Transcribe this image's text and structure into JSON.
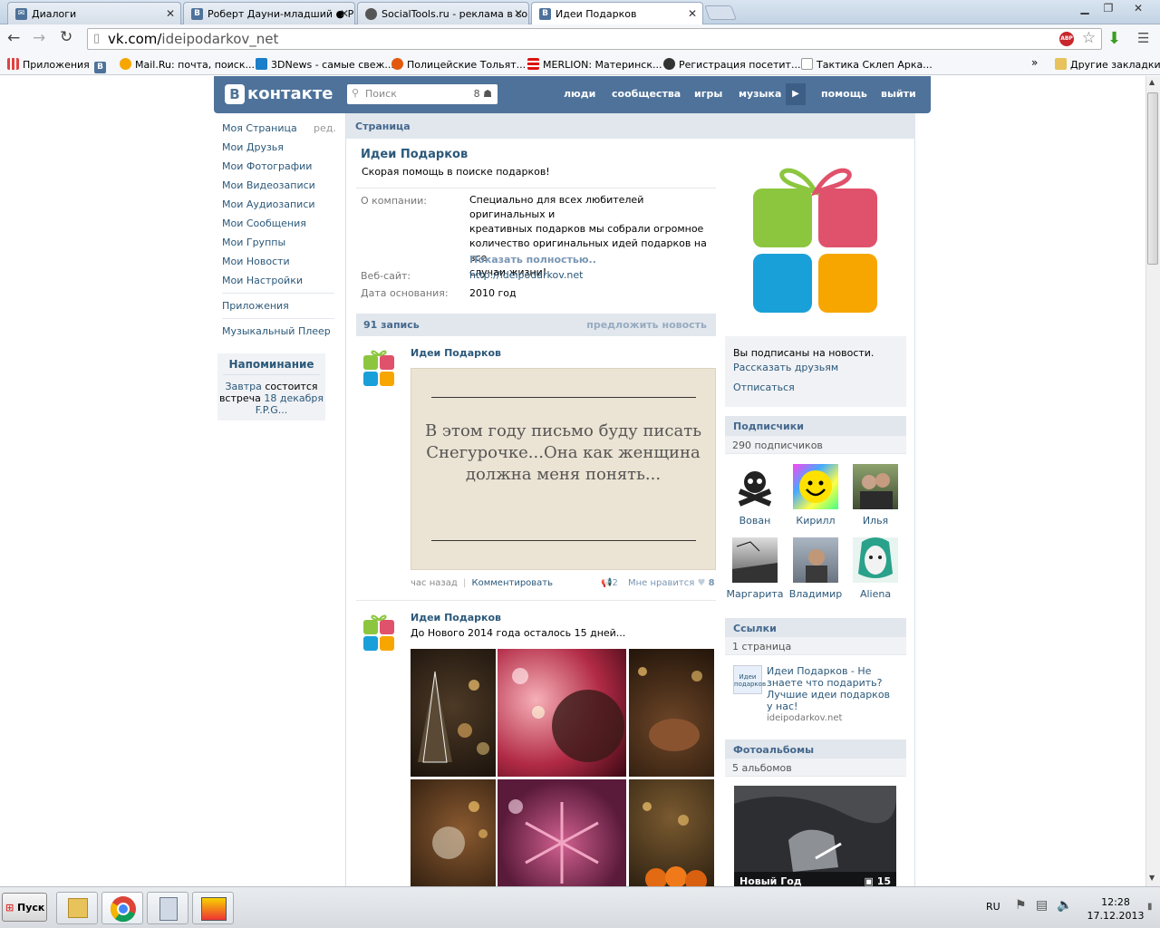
{
  "browser": {
    "tabs": [
      {
        "title": "Диалоги"
      },
      {
        "title": "Роберт Дауни-младший ● Р"
      },
      {
        "title": "SocialTools.ru - реклама в со"
      },
      {
        "title": "Идеи Подарков"
      }
    ],
    "url_host": "vk.com/",
    "url_path": "ideipodarkov_net",
    "bookmarks": [
      {
        "label": "Приложения",
        "icon": "apps-grid-icon"
      },
      {
        "label": "",
        "icon": "vk-icon"
      },
      {
        "label": "Mail.Ru: почта, поиск...",
        "icon": "mailru-icon"
      },
      {
        "label": "3DNews - самые свеж...",
        "icon": "3dnews-icon"
      },
      {
        "label": "Полицейские Тольят...",
        "icon": "police-icon"
      },
      {
        "label": "MERLION: Материнск...",
        "icon": "merlion-icon"
      },
      {
        "label": "Регистрация посетит...",
        "icon": "registration-icon"
      },
      {
        "label": "Тактика Склеп Арка...",
        "icon": "page-icon"
      }
    ],
    "bookmarks_more": "»",
    "other_bookmarks": "Другие закладки"
  },
  "vk": {
    "logo": "контакте",
    "logo_letter": "В",
    "search_placeholder": "Поиск",
    "search_count": "8",
    "nav": [
      "люди",
      "сообщества",
      "игры",
      "музыка",
      "помощь",
      "выйти"
    ],
    "menu": [
      "Моя Страница",
      "Мои Друзья",
      "Мои Фотографии",
      "Мои Видеозаписи",
      "Мои Аудиозаписи",
      "Мои Сообщения",
      "Мои Группы",
      "Мои Новости",
      "Мои Настройки",
      "Приложения",
      "Музыкальный Плеер"
    ],
    "menu_edit": "ред.",
    "reminder": {
      "title": "Напоминание",
      "w1": "Завтра",
      "w2": " состоится",
      "w3": "встреча ",
      "w4": "18 декабря",
      "w5": "F.P.G..."
    }
  },
  "group": {
    "page_title": "Страница",
    "name": "Идеи Подарков",
    "status": "Скорая помощь в поиске подарков!",
    "about_label": "О компании:",
    "about_lines": [
      "Специально для всех любителей оригинальных и",
      "креативных подарков мы собрали огромное",
      "количество оригинальных идей подарков на все",
      "случаи жизни!"
    ],
    "show_full": "Показать полностью..",
    "website_label": "Веб-сайт:",
    "website": "http://ideipodarkov.net",
    "founded_label": "Дата основания:",
    "founded": "2010 год",
    "colors": {
      "green": "#8cc63f",
      "red": "#e0516b",
      "blue": "#1aa0d8",
      "orange": "#f7a600"
    }
  },
  "wall": {
    "count": "91 запись",
    "suggest": "предложить новость",
    "posts": [
      {
        "author": "Идеи Подарков",
        "image_lines": [
          "В этом году письмо буду писать",
          "Снегурочке...Она как женщина",
          "должна меня понять..."
        ],
        "time": "час назад",
        "sep": "|",
        "comment": "Комментировать",
        "shares": "2",
        "like_label": "Мне нравится",
        "likes": "8"
      },
      {
        "author": "Идеи Подарков",
        "text": "До Нового 2014 года осталось 15 дней..."
      }
    ]
  },
  "sidebar": {
    "subscribed": "Вы подписаны на новости.",
    "tell_friends": "Рассказать друзьям",
    "unsubscribe": "Отписаться",
    "followers_title": "Подписчики",
    "followers_count": "290 подписчиков",
    "followers": [
      "Вован",
      "Кирилл",
      "Илья",
      "Маргарита",
      "Владимир",
      "Aliena"
    ],
    "links_title": "Ссылки",
    "links_count": "1 страница",
    "link_text": "Идеи Подарков - Не знаете что подарить? Лучшие идеи подарков у нас!",
    "link_url": "ideipodarkov.net",
    "link_thumb": "Идеи подарков",
    "albums_title": "Фотоальбомы",
    "albums_count": "5 альбомов",
    "album_name": "Новый Год",
    "album_photos": "15"
  },
  "taskbar": {
    "start": "Пуск",
    "lang": "RU",
    "time": "12:28",
    "date": "17.12.2013"
  }
}
